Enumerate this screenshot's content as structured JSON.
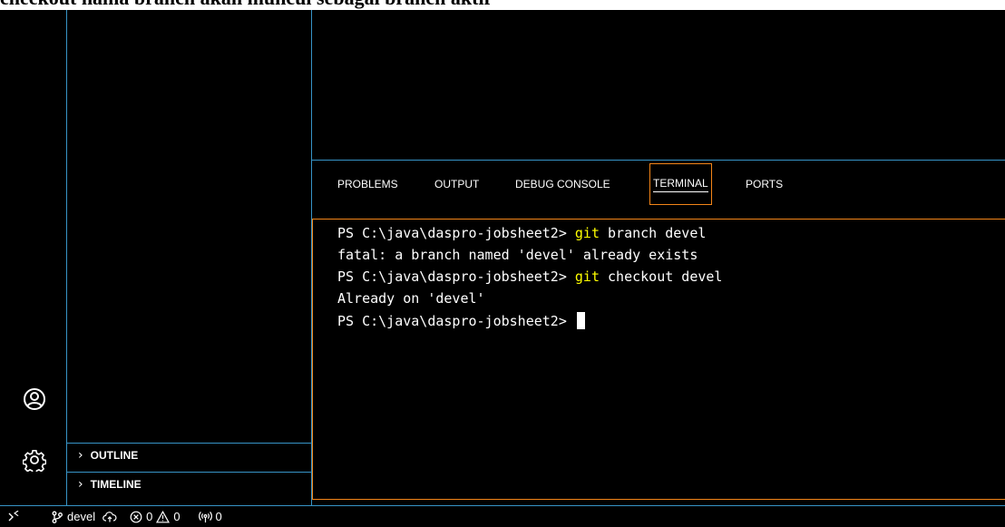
{
  "top_caption": "checkout nama branch akan muncul sebagai branch aktif",
  "panel": {
    "tabs": [
      {
        "label": "PROBLEMS"
      },
      {
        "label": "OUTPUT"
      },
      {
        "label": "DEBUG CONSOLE"
      },
      {
        "label": "TERMINAL",
        "active": true
      },
      {
        "label": "PORTS"
      }
    ]
  },
  "terminal": {
    "lines": [
      {
        "prompt": "PS C:\\java\\daspro-jobsheet2> ",
        "cmd": "git",
        "args": " branch devel"
      },
      {
        "text": "fatal: a branch named 'devel' already exists"
      },
      {
        "prompt": "PS C:\\java\\daspro-jobsheet2> ",
        "cmd": "git",
        "args": " checkout devel"
      },
      {
        "text": "Already on 'devel'"
      },
      {
        "prompt": "PS C:\\java\\daspro-jobsheet2> "
      }
    ]
  },
  "sidebar": {
    "sections": [
      {
        "label": "OUTLINE"
      },
      {
        "label": "TIMELINE"
      }
    ]
  },
  "status_bar": {
    "branch": "devel",
    "errors": "0",
    "warnings": "0",
    "ports": "0"
  },
  "colors": {
    "border_blue": "#3794c7",
    "focus_orange": "#f38518",
    "command_yellow": "#ffff00",
    "background": "#000000"
  },
  "icons": {
    "activity_bar": [
      "account-icon",
      "gear-icon"
    ],
    "status_bar": [
      "remote-icon",
      "git-branch-icon",
      "cloud-upload-icon",
      "error-icon",
      "warning-icon",
      "ports-icon"
    ]
  }
}
